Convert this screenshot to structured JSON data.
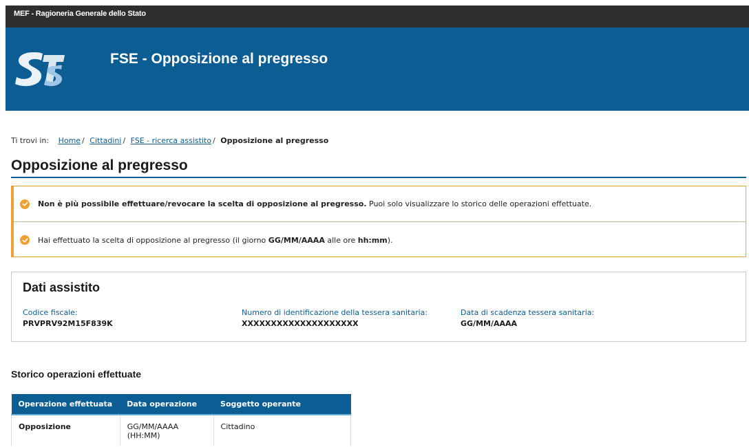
{
  "topbar": {
    "text": "MEF - Ragioneria Generale dello Stato"
  },
  "header": {
    "logo_icon": "sts-logo",
    "title": "FSE - Opposizione al pregresso"
  },
  "breadcrumb": {
    "lead": "Ti trovi in:",
    "items": [
      "Home",
      "Cittadini",
      "FSE - ricerca assistito"
    ],
    "current": "Opposizione al pregresso"
  },
  "page": {
    "title": "Opposizione al pregresso"
  },
  "alerts": {
    "icon": "check-circle-icon",
    "first": {
      "bold": "Non è più possibile effettuare/revocare la scelta di opposizione al pregresso.",
      "rest": " Puoi solo visualizzare lo storico delle operazioni effettuate."
    },
    "second": {
      "part1": "Hai effettuato la scelta di opposizione al pregresso (il giorno ",
      "date": "GG/MM/AAAA",
      "part2": " alle ore ",
      "time": "hh:mm",
      "part3": ")."
    }
  },
  "assistito": {
    "title": "Dati assistito",
    "codice_fiscale_label": "Codice fiscale:",
    "codice_fiscale": "PRVPRV92M15F839K",
    "tessera_label": "Numero di identificazione della tessera sanitaria:",
    "tessera": "XXXXXXXXXXXXXXXXXXXX",
    "scadenza_label": "Data di scadenza tessera sanitaria:",
    "scadenza": "GG/MM/AAAA"
  },
  "history": {
    "title": "Storico operazioni effettuate",
    "columns": [
      "Operazione effettuata",
      "Data operazione",
      "Soggetto operante"
    ],
    "rows": [
      {
        "operation": "Opposizione",
        "date": "GG/MM/AAAA",
        "time": "(HH:MM)",
        "subject": "Cittadino"
      }
    ]
  },
  "colors": {
    "brand_blue": "#0b5d94",
    "warning_orange": "#f0a030",
    "topbar": "#2e2e2e"
  }
}
